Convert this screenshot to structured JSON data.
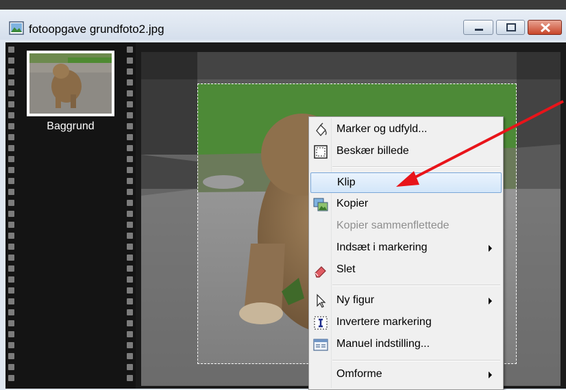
{
  "window": {
    "title": "fotoopgave grundfoto2.jpg",
    "app_icon": "image-file-icon",
    "buttons": [
      "minimize",
      "maximize",
      "close"
    ]
  },
  "layers": [
    {
      "name": "Baggrund"
    }
  ],
  "context_menu": {
    "items": [
      {
        "label": "Marker og udfyld...",
        "icon": "paint-bucket-icon"
      },
      {
        "label": "Beskær billede",
        "icon": "crop-icon"
      },
      {
        "separator": true
      },
      {
        "label": "Klip",
        "highlighted": true
      },
      {
        "label": "Kopier",
        "icon": "copy-image-icon"
      },
      {
        "label": "Kopier sammenflettede",
        "disabled": true
      },
      {
        "label": "Indsæt i markering",
        "submenu": true
      },
      {
        "label": "Slet",
        "icon": "eraser-icon"
      },
      {
        "separator": true
      },
      {
        "label": "Ny figur",
        "icon": "pointer-icon",
        "submenu": true
      },
      {
        "label": "Invertere markering",
        "icon": "text-cursor-icon"
      },
      {
        "label": "Manuel indstilling...",
        "icon": "window-settings-icon"
      },
      {
        "separator": true
      },
      {
        "label": "Omforme",
        "submenu": true
      }
    ]
  },
  "colors": {
    "annotation_arrow": "#e8141a",
    "menu_highlight": "#d3e6f9",
    "filmstrip": "#141414"
  }
}
